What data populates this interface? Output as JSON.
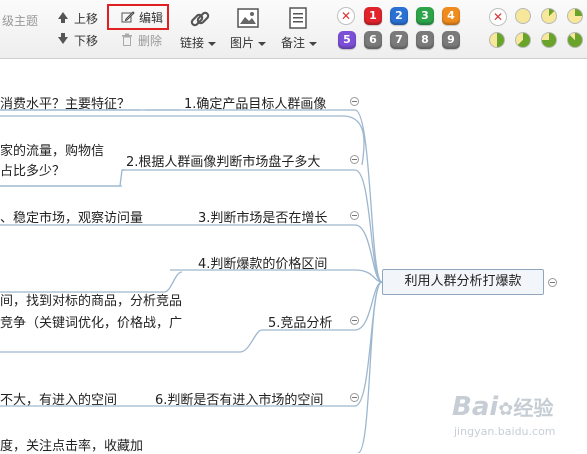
{
  "toolbar": {
    "partial_label": "级主题",
    "move_up": "上移",
    "move_down": "下移",
    "edit": "编辑",
    "delete": "删除",
    "link": "链接",
    "image": "图片",
    "note": "备注",
    "priority_badges": [
      {
        "label": "1",
        "color": "#e0242c"
      },
      {
        "label": "2",
        "color": "#2a71d4"
      },
      {
        "label": "3",
        "color": "#2ea44a"
      },
      {
        "label": "4",
        "color": "#f08c1e"
      },
      {
        "label": "5",
        "color": "#7b4fd6"
      },
      {
        "label": "6",
        "color": "#7a7a7a"
      },
      {
        "label": "7",
        "color": "#7a7a7a"
      },
      {
        "label": "8",
        "color": "#7a7a7a"
      },
      {
        "label": "9",
        "color": "#7a7a7a"
      }
    ],
    "progress_levels": [
      0,
      0,
      0.125,
      0.25,
      0.375,
      0.5,
      0.625,
      0.75,
      0.875
    ]
  },
  "mindmap": {
    "central": "利用人群分析打爆款",
    "branches": [
      {
        "label": "1.确定产品目标人群画像",
        "child": "消费水平？主要特征？"
      },
      {
        "label": "2.根据人群画像判断市场盘子多大",
        "child_lines": [
          "家的流量，购物信",
          "占比多少？"
        ]
      },
      {
        "label": "3.判断市场是否在增长",
        "child": "、稳定市场，观察访问量"
      },
      {
        "label": "4.判断爆款的价格区间",
        "child": ""
      },
      {
        "label": "5.竞品分析",
        "child_lines": [
          "间，找到对标的商品，分析竞品",
          "竞争（关键词优化，价格战，广"
        ]
      },
      {
        "label": "6.判断是否有进入市场的空间",
        "child": "不大，有进入的空间"
      },
      {
        "label": "",
        "child": "度，关注点击率，收藏加"
      }
    ]
  },
  "watermark": {
    "brand": "Bai",
    "brand2": "经验",
    "url": "jingyan.baidu.com"
  }
}
